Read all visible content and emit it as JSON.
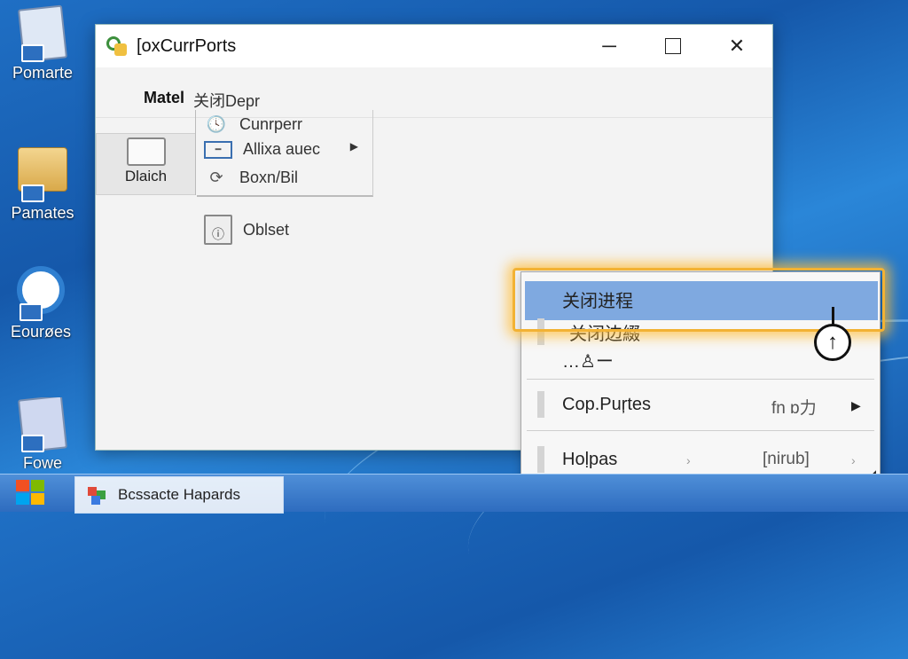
{
  "desktop": {
    "icons": [
      {
        "label": "Pomarte",
        "icon": "document-icon"
      },
      {
        "label": "Pamates",
        "icon": "folder-icon"
      },
      {
        "label": "Eourøes",
        "icon": "disc-icon"
      },
      {
        "label": "Fowe",
        "icon": "notepad-icon"
      }
    ]
  },
  "window": {
    "title": "[oxCurrPorts",
    "controls": {
      "minimize": "─",
      "close": "✕"
    }
  },
  "menubar": {
    "item1": "Matel",
    "item2": "关闭Depr"
  },
  "toolpanel": {
    "label": "Dlaich"
  },
  "submenu": {
    "items": [
      {
        "label": "Cunrperr",
        "icon": "document-clock-icon"
      },
      {
        "label": "Allixa auec",
        "icon": "keyboard-icon"
      },
      {
        "label": "Boxn/Bil",
        "icon": "refresh-icon"
      }
    ],
    "arrow": "▶"
  },
  "object_item": {
    "label": "Oblset",
    "icon": "info-document-icon"
  },
  "context_menu": {
    "items": [
      {
        "label": "关闭进程",
        "highlighted": true
      },
      {
        "label": "关闭边綴"
      },
      {
        "label": "…♙ー"
      },
      {
        "label": "Cop.Puŗtes",
        "shortcut": "fn ɒ力"
      },
      {
        "label": "Hoḷpas",
        "shortcut": "[nirub]"
      }
    ],
    "arrow": "▶"
  },
  "cursor": {
    "glyph": "↑"
  },
  "taskbar": {
    "task_label": "Bcssacte Hapards"
  },
  "colors": {
    "highlight": "#7fa9e0",
    "glow": "#f2b234",
    "taskbar": "#2e6cbf"
  }
}
